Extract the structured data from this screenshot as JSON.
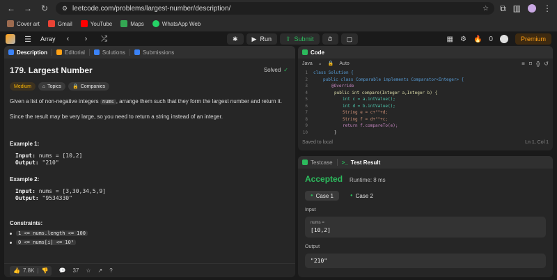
{
  "browser": {
    "url": "leetcode.com/problems/largest-number/description/",
    "bookmarks": [
      {
        "label": "Cover art"
      },
      {
        "label": "Gmail"
      },
      {
        "label": "YouTube"
      },
      {
        "label": "Maps"
      },
      {
        "label": "WhatsApp Web"
      }
    ]
  },
  "lc_topbar": {
    "list_label": "Array",
    "run_label": "Run",
    "submit_label": "Submit",
    "count": "0",
    "premium_label": "Premium"
  },
  "description_panel": {
    "tabs": [
      "Description",
      "Editorial",
      "Solutions",
      "Submissions"
    ],
    "title": "179. Largest Number",
    "solved_label": "Solved",
    "tags": [
      "Medium",
      "Topics",
      "Companies"
    ],
    "para1_before": "Given a list of non-negative integers ",
    "para1_code": "nums",
    "para1_after": ", arrange them such that they form the largest number and return it.",
    "para2": "Since the result may be very large, so you need to return a string instead of an integer.",
    "examples": [
      {
        "title": "Example 1:",
        "input": "nums = [10,2]",
        "output": "\"210\""
      },
      {
        "title": "Example 2:",
        "input": "nums = [3,30,34,5,9]",
        "output": "\"9534330\""
      }
    ],
    "input_label": "Input:",
    "output_label": "Output:",
    "constraints_title": "Constraints:",
    "constraints": [
      "1 <= nums.length <= 100",
      "0 <= nums[i] <= 10⁹"
    ],
    "footer": {
      "likes": "7.8K",
      "comments": "37"
    }
  },
  "code_panel": {
    "title": "Code",
    "language": "Java",
    "autocomplete": "Auto",
    "status_left": "Saved to local",
    "status_right": "Ln 1, Col 1",
    "lines": [
      "1",
      "2",
      "3",
      "4",
      "5",
      "6",
      "7",
      "8",
      "9",
      "10"
    ],
    "code_text": {
      "l1": "class Solution {",
      "l2": "public class Comparable implements Comparator<Integer> {",
      "l3": "@Override",
      "l4": "public int compare(Integer a,Integer b) {",
      "l5": "int c = a.intValue();",
      "l6": "int d = b.intValue();",
      "l7": "String e = c+\"\"+d;",
      "l8": "String f = d+\"\"+c;",
      "l9": "return f.compareTo(e);",
      "l10": "}"
    }
  },
  "result_panel": {
    "tabs": [
      "Testcase",
      "Test Result"
    ],
    "status": "Accepted",
    "runtime": "Runtime: 8 ms",
    "cases": [
      "Case 1",
      "Case 2"
    ],
    "input_label": "Input",
    "var_label": "nums =",
    "input_value": "[10,2]",
    "output_label": "Output",
    "output_value": "\"210\""
  },
  "colors": {
    "accent_green": "#2cbb5d",
    "accent_orange": "#ffa116",
    "medium_tag": "#ffb800",
    "bg": "#1a1a1a",
    "panel": "#262626"
  }
}
